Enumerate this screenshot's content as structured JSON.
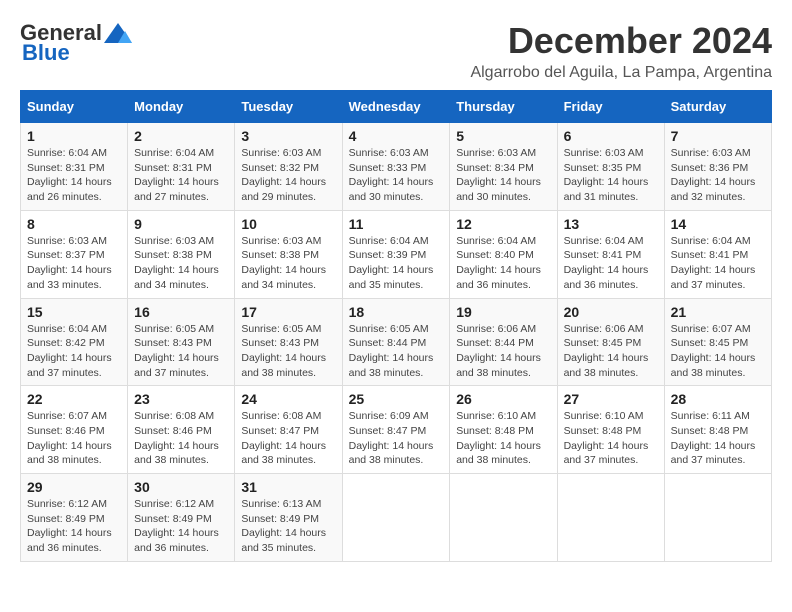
{
  "logo": {
    "general": "General",
    "blue": "Blue"
  },
  "title": {
    "month": "December 2024",
    "location": "Algarrobo del Aguila, La Pampa, Argentina"
  },
  "weekdays": [
    "Sunday",
    "Monday",
    "Tuesday",
    "Wednesday",
    "Thursday",
    "Friday",
    "Saturday"
  ],
  "weeks": [
    [
      {
        "day": "1",
        "info": "Sunrise: 6:04 AM\nSunset: 8:31 PM\nDaylight: 14 hours\nand 26 minutes."
      },
      {
        "day": "2",
        "info": "Sunrise: 6:04 AM\nSunset: 8:31 PM\nDaylight: 14 hours\nand 27 minutes."
      },
      {
        "day": "3",
        "info": "Sunrise: 6:03 AM\nSunset: 8:32 PM\nDaylight: 14 hours\nand 29 minutes."
      },
      {
        "day": "4",
        "info": "Sunrise: 6:03 AM\nSunset: 8:33 PM\nDaylight: 14 hours\nand 30 minutes."
      },
      {
        "day": "5",
        "info": "Sunrise: 6:03 AM\nSunset: 8:34 PM\nDaylight: 14 hours\nand 30 minutes."
      },
      {
        "day": "6",
        "info": "Sunrise: 6:03 AM\nSunset: 8:35 PM\nDaylight: 14 hours\nand 31 minutes."
      },
      {
        "day": "7",
        "info": "Sunrise: 6:03 AM\nSunset: 8:36 PM\nDaylight: 14 hours\nand 32 minutes."
      }
    ],
    [
      {
        "day": "8",
        "info": "Sunrise: 6:03 AM\nSunset: 8:37 PM\nDaylight: 14 hours\nand 33 minutes."
      },
      {
        "day": "9",
        "info": "Sunrise: 6:03 AM\nSunset: 8:38 PM\nDaylight: 14 hours\nand 34 minutes."
      },
      {
        "day": "10",
        "info": "Sunrise: 6:03 AM\nSunset: 8:38 PM\nDaylight: 14 hours\nand 34 minutes."
      },
      {
        "day": "11",
        "info": "Sunrise: 6:04 AM\nSunset: 8:39 PM\nDaylight: 14 hours\nand 35 minutes."
      },
      {
        "day": "12",
        "info": "Sunrise: 6:04 AM\nSunset: 8:40 PM\nDaylight: 14 hours\nand 36 minutes."
      },
      {
        "day": "13",
        "info": "Sunrise: 6:04 AM\nSunset: 8:41 PM\nDaylight: 14 hours\nand 36 minutes."
      },
      {
        "day": "14",
        "info": "Sunrise: 6:04 AM\nSunset: 8:41 PM\nDaylight: 14 hours\nand 37 minutes."
      }
    ],
    [
      {
        "day": "15",
        "info": "Sunrise: 6:04 AM\nSunset: 8:42 PM\nDaylight: 14 hours\nand 37 minutes."
      },
      {
        "day": "16",
        "info": "Sunrise: 6:05 AM\nSunset: 8:43 PM\nDaylight: 14 hours\nand 37 minutes."
      },
      {
        "day": "17",
        "info": "Sunrise: 6:05 AM\nSunset: 8:43 PM\nDaylight: 14 hours\nand 38 minutes."
      },
      {
        "day": "18",
        "info": "Sunrise: 6:05 AM\nSunset: 8:44 PM\nDaylight: 14 hours\nand 38 minutes."
      },
      {
        "day": "19",
        "info": "Sunrise: 6:06 AM\nSunset: 8:44 PM\nDaylight: 14 hours\nand 38 minutes."
      },
      {
        "day": "20",
        "info": "Sunrise: 6:06 AM\nSunset: 8:45 PM\nDaylight: 14 hours\nand 38 minutes."
      },
      {
        "day": "21",
        "info": "Sunrise: 6:07 AM\nSunset: 8:45 PM\nDaylight: 14 hours\nand 38 minutes."
      }
    ],
    [
      {
        "day": "22",
        "info": "Sunrise: 6:07 AM\nSunset: 8:46 PM\nDaylight: 14 hours\nand 38 minutes."
      },
      {
        "day": "23",
        "info": "Sunrise: 6:08 AM\nSunset: 8:46 PM\nDaylight: 14 hours\nand 38 minutes."
      },
      {
        "day": "24",
        "info": "Sunrise: 6:08 AM\nSunset: 8:47 PM\nDaylight: 14 hours\nand 38 minutes."
      },
      {
        "day": "25",
        "info": "Sunrise: 6:09 AM\nSunset: 8:47 PM\nDaylight: 14 hours\nand 38 minutes."
      },
      {
        "day": "26",
        "info": "Sunrise: 6:10 AM\nSunset: 8:48 PM\nDaylight: 14 hours\nand 38 minutes."
      },
      {
        "day": "27",
        "info": "Sunrise: 6:10 AM\nSunset: 8:48 PM\nDaylight: 14 hours\nand 37 minutes."
      },
      {
        "day": "28",
        "info": "Sunrise: 6:11 AM\nSunset: 8:48 PM\nDaylight: 14 hours\nand 37 minutes."
      }
    ],
    [
      {
        "day": "29",
        "info": "Sunrise: 6:12 AM\nSunset: 8:49 PM\nDaylight: 14 hours\nand 36 minutes."
      },
      {
        "day": "30",
        "info": "Sunrise: 6:12 AM\nSunset: 8:49 PM\nDaylight: 14 hours\nand 36 minutes."
      },
      {
        "day": "31",
        "info": "Sunrise: 6:13 AM\nSunset: 8:49 PM\nDaylight: 14 hours\nand 35 minutes."
      },
      null,
      null,
      null,
      null
    ]
  ]
}
